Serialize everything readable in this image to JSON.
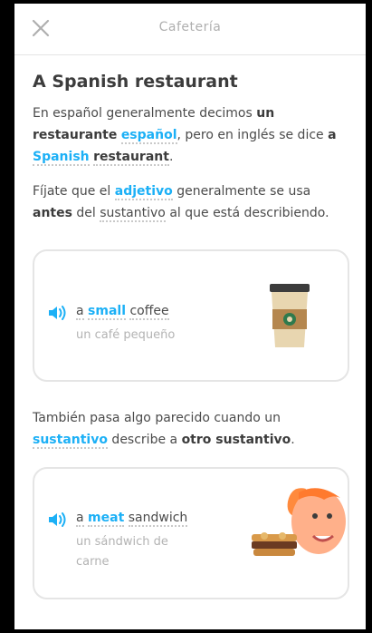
{
  "header": {
    "title": "Cafetería",
    "close_icon": "close-icon"
  },
  "lesson": {
    "heading": "A Spanish restaurant",
    "para1": {
      "t1": "En español generalmente decimos ",
      "t2": "un restaurante",
      "t3": " ",
      "t4": "español",
      "t5": ", pero en inglés se dice ",
      "t6": "a",
      "t7": " ",
      "t8": "Spanish",
      "t9": " ",
      "t10": "restaurant",
      "t11": "."
    },
    "para2": {
      "t1": "Fíjate que el ",
      "t2": "adjetivo",
      "t3": " generalmente se usa ",
      "t4": "antes",
      "t5": " del ",
      "t6": "sustantivo",
      "t7": " al que está describiendo."
    },
    "para3": {
      "t1": "También pasa algo parecido cuando un ",
      "t2": "sustantivo",
      "t3": " describe a ",
      "t4": "otro sustantivo",
      "t5": "."
    }
  },
  "examples": [
    {
      "w1": "a",
      "w2": "small",
      "w3": "coffee",
      "translation": "un café pequeño",
      "illustration": "coffee-cup-icon"
    },
    {
      "w1": "a",
      "w2": "meat",
      "w3": "sandwich",
      "translation": "un sándwich de carne",
      "illustration": "person-eating-sandwich-icon"
    }
  ],
  "colors": {
    "accent_blue": "#1cb0f6",
    "text": "#4b4b4b",
    "muted": "#afafaf",
    "border": "#e5e5e5"
  }
}
